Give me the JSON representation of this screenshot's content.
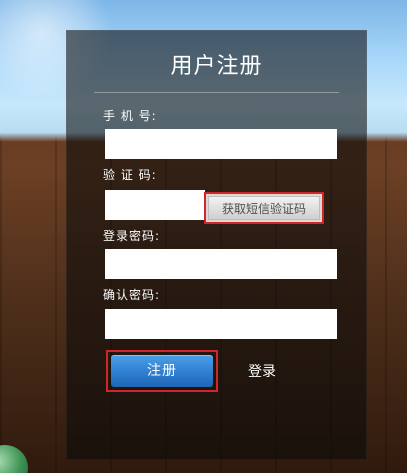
{
  "form": {
    "title": "用户注册",
    "phone_label": "手 机 号:",
    "code_label": "验 证 码:",
    "password_label": "登录密码:",
    "confirm_password_label": "确认密码:",
    "sms_button_label": "获取短信验证码",
    "register_button_label": "注册",
    "login_link_label": "登录",
    "phone_value": "",
    "code_value": "",
    "password_value": "",
    "confirm_password_value": ""
  },
  "colors": {
    "panel_overlay": "#0a0a0a",
    "primary_button": "#2f7fd1",
    "highlight_border": "#d0262a"
  },
  "icons": {
    "background_left": "cloud-icon",
    "background_bottom_left": "green-orb-icon"
  }
}
